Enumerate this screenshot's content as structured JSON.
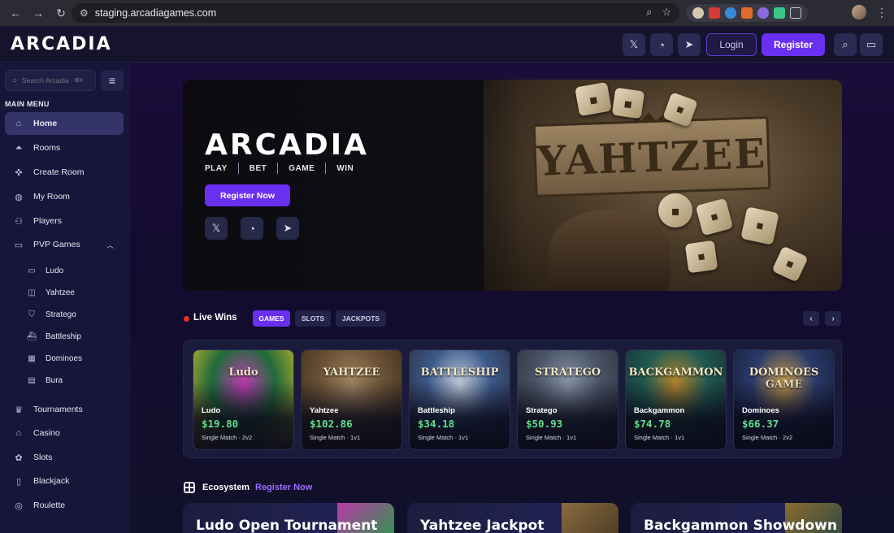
{
  "browser": {
    "url": "staging.arcadiagames.com"
  },
  "header": {
    "logo": "ARCADIA",
    "login_label": "Login",
    "register_label": "Register"
  },
  "sidebar": {
    "search_placeholder": "Search Arcadia",
    "search_shortcut": "⌘K",
    "menu_heading": "MAIN MENU",
    "items": [
      {
        "label": "Home",
        "icon": "home-icon",
        "glyph": "⌂"
      },
      {
        "label": "Rooms",
        "icon": "rooms-icon",
        "glyph": "⏶"
      },
      {
        "label": "Create Room",
        "icon": "create-room-icon",
        "glyph": "✜"
      },
      {
        "label": "My Room",
        "icon": "my-room-icon",
        "glyph": "◍"
      },
      {
        "label": "Players",
        "icon": "players-icon",
        "glyph": "⚇"
      },
      {
        "label": "PVP Games",
        "icon": "pvp-icon",
        "glyph": "▭"
      }
    ],
    "sub_items": [
      {
        "label": "Ludo",
        "icon": "gamepad-icon",
        "glyph": "▭"
      },
      {
        "label": "Yahtzee",
        "icon": "board-icon",
        "glyph": "◫"
      },
      {
        "label": "Stratego",
        "icon": "shield-icon",
        "glyph": "⛉"
      },
      {
        "label": "Battleship",
        "icon": "ship-icon",
        "glyph": "⛴"
      },
      {
        "label": "Dominoes",
        "icon": "grid-icon",
        "glyph": "▦"
      },
      {
        "label": "Bura",
        "icon": "cards-icon",
        "glyph": "▤"
      }
    ],
    "bottom_items": [
      {
        "label": "Tournaments",
        "icon": "trophy-icon",
        "glyph": "♛"
      },
      {
        "label": "Casino",
        "icon": "casino-icon",
        "glyph": "⌂"
      },
      {
        "label": "Slots",
        "icon": "slots-icon",
        "glyph": "✿"
      },
      {
        "label": "Blackjack",
        "icon": "blackjack-icon",
        "glyph": "▯"
      },
      {
        "label": "Roulette",
        "icon": "roulette-icon",
        "glyph": "◎"
      }
    ]
  },
  "hero": {
    "title": "ARCADIA",
    "tags": [
      "PLAY",
      "BET",
      "GAME",
      "WIN"
    ],
    "cta_label": "Register Now",
    "art_text": "YAHTZEE"
  },
  "live_wins": {
    "title": "Live Wins",
    "tabs": [
      "GAMES",
      "SLOTS",
      "JACKPOTS"
    ],
    "active_tab": "GAMES",
    "cards": [
      {
        "art_title": "Ludo",
        "game": "Ludo",
        "amount": "$19.80",
        "meta": "Single Match · 2v2",
        "colors": [
          "#1f6b3a",
          "#c43ab8",
          "#e0c02a"
        ]
      },
      {
        "art_title": "YAHTZEE",
        "game": "Yahtzee",
        "amount": "$102.86",
        "meta": "Single Match · 1v1",
        "colors": [
          "#6b5236",
          "#a08660",
          "#3a2a1a"
        ]
      },
      {
        "art_title": "BATTLESHIP",
        "game": "Battleship",
        "amount": "$34.18",
        "meta": "Single Match · 1v1",
        "colors": [
          "#3b5a8a",
          "#c6cfe0",
          "#2a2a3a"
        ]
      },
      {
        "art_title": "STRATEGO",
        "game": "Stratego",
        "amount": "$50.93",
        "meta": "Single Match · 1v1",
        "colors": [
          "#4a5566",
          "#8a96a8",
          "#2a2e38"
        ]
      },
      {
        "art_title": "BACKGAMMON",
        "game": "Backgammon",
        "amount": "$74.78",
        "meta": "Single Match · 1v1",
        "colors": [
          "#1f5a52",
          "#b8862a",
          "#1a2a30"
        ]
      },
      {
        "art_title": "DOMINOES GAME",
        "game": "Dominoes",
        "amount": "$66.37",
        "meta": "Single Match · 2v2",
        "colors": [
          "#2a3a6a",
          "#c89a4a",
          "#141a30"
        ]
      }
    ]
  },
  "ecosystem": {
    "title": "Ecosystem",
    "link_label": "Register Now",
    "promos": [
      {
        "title": "Ludo Open Tournament",
        "colors": [
          "#b83aa8",
          "#2a9a4a"
        ]
      },
      {
        "title": "Yahtzee Jackpot",
        "colors": [
          "#8a6a40",
          "#4a3a24"
        ]
      },
      {
        "title": "Backgammon Showdown",
        "colors": [
          "#8a6a30",
          "#2a4a44"
        ]
      }
    ]
  },
  "colors": {
    "accent": "#6a2ff0",
    "win_green": "#5fe08a",
    "live_red": "#e23030"
  }
}
